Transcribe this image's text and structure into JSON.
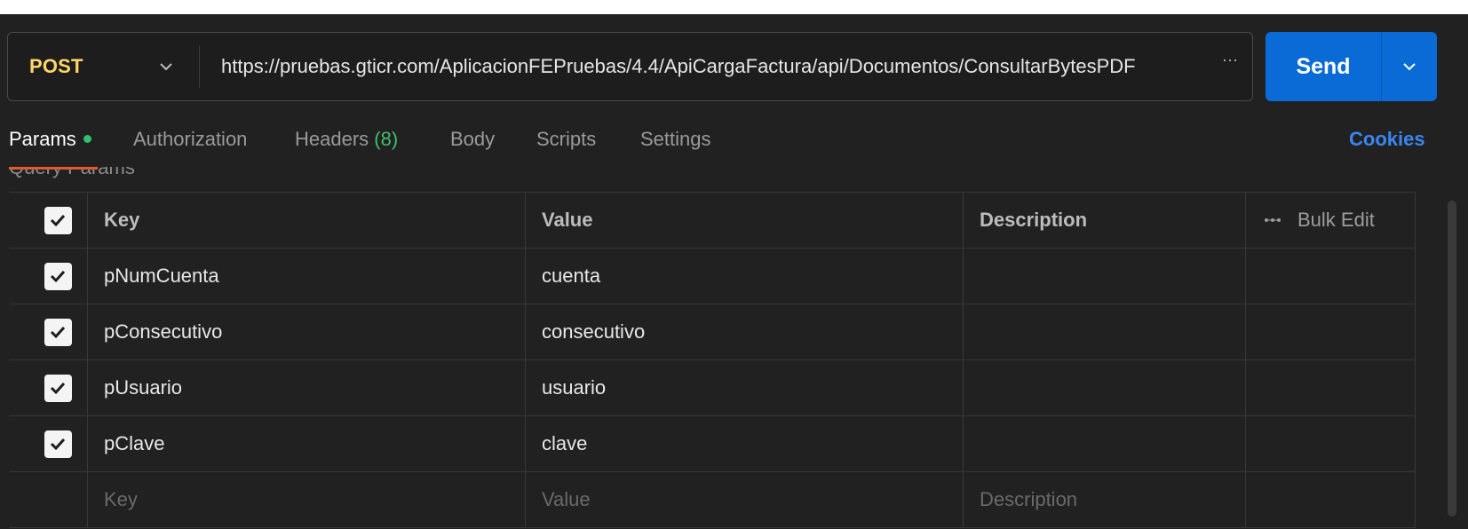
{
  "request": {
    "method": "POST",
    "url": "https://pruebas.gticr.com/AplicacionFEPruebas/4.4/ApiCargaFactura/api/Documentos/ConsultarBytesPDF",
    "url_more": "···",
    "send_label": "Send"
  },
  "tabs": {
    "params": "Params",
    "authorization": "Authorization",
    "headers": "Headers",
    "headers_count": "(8)",
    "body": "Body",
    "scripts": "Scripts",
    "settings": "Settings",
    "cookies": "Cookies"
  },
  "section_label": "Query Params",
  "table": {
    "headers": {
      "key": "Key",
      "value": "Value",
      "description": "Description",
      "bulk_edit": "Bulk Edit"
    },
    "rows": [
      {
        "key": "pNumCuenta",
        "value": "cuenta",
        "description": "",
        "checked": true
      },
      {
        "key": "pConsecutivo",
        "value": "consecutivo",
        "description": "",
        "checked": true
      },
      {
        "key": "pUsuario",
        "value": "usuario",
        "description": "",
        "checked": true
      },
      {
        "key": "pClave",
        "value": "clave",
        "description": "",
        "checked": true
      }
    ],
    "placeholders": {
      "key": "Key",
      "value": "Value",
      "description": "Description"
    }
  },
  "colors": {
    "method": "#ffd666",
    "send": "#0a6bd6",
    "cookies": "#3a86f0",
    "active_dot": "#2fbf71",
    "headers_count": "#3fbf6b",
    "background": "#212121"
  },
  "icons": {
    "method_dropdown": "chevron-down-icon",
    "send_dropdown": "chevron-down-icon",
    "bulk_edit": "bulk-edit-icon",
    "row_check": "checkmark-icon"
  }
}
